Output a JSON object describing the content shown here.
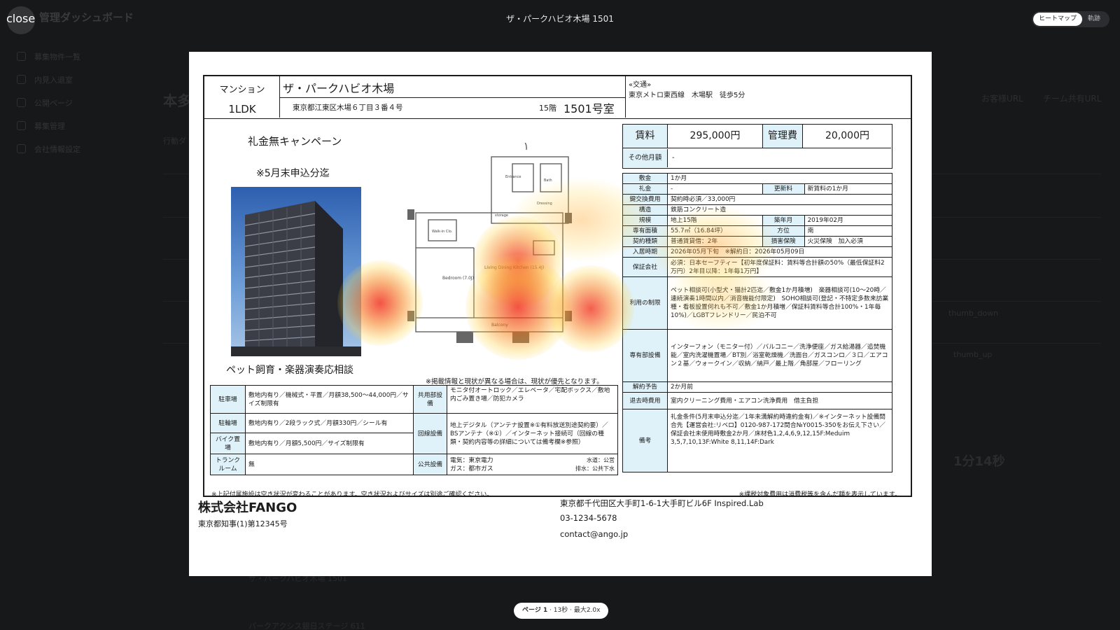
{
  "background_app": {
    "title": "管理ダッシュボード",
    "sidebar": [
      "募集物件一覧",
      "内見入退室",
      "公開ページ",
      "募集管理",
      "会社情報設定"
    ],
    "main_title": "本多",
    "main_label": "行動ダ",
    "right_links": [
      "お客様URL",
      "チーム共有URL"
    ],
    "big_time": "1分14秒",
    "thumb_down": "thumb_down",
    "thumb_up": "thumb_up",
    "bottom_rows": [
      "ザ・パークハビオ木場 1501",
      "パークアクシス銀日ステージ 611"
    ]
  },
  "viewer": {
    "close_label": "close",
    "title": "ザ・パークハビオ木場 1501",
    "toggle": [
      {
        "label": "ヒートマップ",
        "active": true
      },
      {
        "label": "軌跡",
        "active": false
      }
    ],
    "page_info": {
      "page": "ページ 1",
      "detail": " · 13秒 · 最大2.0x"
    }
  },
  "document": {
    "header": {
      "type": "マンション",
      "layout": "1LDK",
      "name": "ザ・パークハビオ木場",
      "address": "東京都江東区木場６丁目３番４号",
      "floor": "15階",
      "room": "1501号室",
      "access_title": "«交通»",
      "access": "東京メトロ東西線　木場駅　徒歩5分"
    },
    "campaign": "礼金無キャンペーン",
    "deadline": "※5月末申込分迄",
    "pet": "ペット飼育・楽器演奏応相談",
    "disclaimer": "※掲載情報と現状が異なる場合は、現状が優先となります。",
    "rent": {
      "rent_label": "賃料",
      "rent_value": "295,000円",
      "fee_label": "管理費",
      "fee_value": "20,000円",
      "other_label": "その他月額",
      "other_value": "-"
    },
    "details": {
      "deposit_k": "敷金",
      "deposit_v": "1か月",
      "key_k": "礼金",
      "key_v": "-",
      "renew_k": "更新料",
      "renew_v": "新賃料の1か月",
      "lock_k": "鍵交換費用",
      "lock_v": "契約時必須／33,000円",
      "struct_k": "構造",
      "struct_v": "鉄筋コンクリート造",
      "scale_k": "規模",
      "scale_v": "地上15階",
      "built_k": "築年月",
      "built_v": "2019年02月",
      "area_k": "専有面積",
      "area_v": "55.7㎡（16.84坪）",
      "dir_k": "方位",
      "dir_v": "南",
      "contract_k": "契約種類",
      "contract_v": "普通賃貸借：2年",
      "ins_k": "損害保険",
      "ins_v": "火災保険　加入必須",
      "move_k": "入居時期",
      "move_v": "2026年05月下旬　※解約日：2026年05月09日",
      "guar_k": "保証会社",
      "guar_v": "必須：日本セーフティー【初年度保証料：賃料等合計額の50%（最低保証料2万円）2年目以降：1年毎1万円】",
      "use_k": "利用の制限",
      "use_v": "ペット相談可(小型犬・猫計2匹迄／敷金1か月積増)　楽器相談可(10～20時／連続演奏1時間以内／消音機能付限定)　SOHO相談可(登記・不特定多数来訪業種・看板設置何れも不可／敷金1か月積増／保証料賃料等合計100%・1年毎10%)／LGBTフレンドリー／民泊不可",
      "equip_k": "専有部設備",
      "equip_v": "インターフォン（モニター付）／バルコニー／洗浄便座／ガス給湯器／追焚機能／室内洗濯機置場／BT別／浴室乾燥機／洗面台／ガスコンロ／３口／エアコン２基／ウォークイン／収納／納戸／最上階／角部屋／フローリング",
      "notice_k": "解約予告",
      "notice_v": "2か月前",
      "leave_k": "退去時費用",
      "leave_v": "室内クリーニング費用・エアコン洗浄費用　借主負担",
      "note_k": "備考",
      "note_v": "礼金条件(5月末申込分迄／1年未満解約時違約金有)／※インターネット設備問合先【運営会社:リベロ】0120-987-172問合№Y0015-350をお伝え下さい／保証会社未使用時敷金2か月／床材色1,2,4,6,9,12,15F:Meduim 3,5,7,10,13F:White 8,11,14F:Dark"
    },
    "facilities": {
      "park_k": "駐車場",
      "park_v": "敷地内有り／機械式・平置／月額38,500～44,000円／サイズ制限有",
      "common_k": "共用部設備",
      "common_v": "モニタ付オートロック／エレベータ／宅配ボックス／敷地内ごみ置き場／防犯カメラ",
      "bike_k": "駐輪場",
      "bike_v": "敷地内有り／2段ラック式／月額330円／シール有",
      "line_k": "回線設備",
      "line_v": "地上デジタル（アンテナ設置※①有料放送別途契約要）／BSアンテナ（※①）／インターネット接続可（回線の種類・契約内容等の詳細については備考欄※参照）",
      "moto_k": "バイク置場",
      "moto_v": "敷地内有り／月額5,500円／サイズ制限有",
      "trunk_k": "トランクルーム",
      "trunk_v": "無",
      "util_k": "公共設備",
      "util_elec": "電気：東京電力",
      "util_gas": "ガス：都市ガス",
      "util_water": "水道：公営",
      "util_drain": "排水：公共下水"
    },
    "floor_plan": {
      "bedroom": "Bedroom (7.0J)",
      "ldk": "Living Dining Kitchen (15.4J)",
      "balcony": "Balcony",
      "entrance": "Entrance",
      "bath": "Bath",
      "walkin": "Walk-in Clo.",
      "dressing": "Dressing",
      "storage": "storage"
    },
    "foot_left": "※上記付属施設は空き状況が変わることがあります。空き状況およびサイズは別途ご確認ください。",
    "foot_right": "※課税対象費用は消費税等を含んだ額を表示しています。",
    "company": "株式会社FANGO",
    "license": "東京都知事(1)第12345号",
    "company_address": "東京都千代田区大手町1-6-1大手町ビル6F Inspired.Lab",
    "phone": "03-1234-5678",
    "email": "contact@ango.jp"
  }
}
